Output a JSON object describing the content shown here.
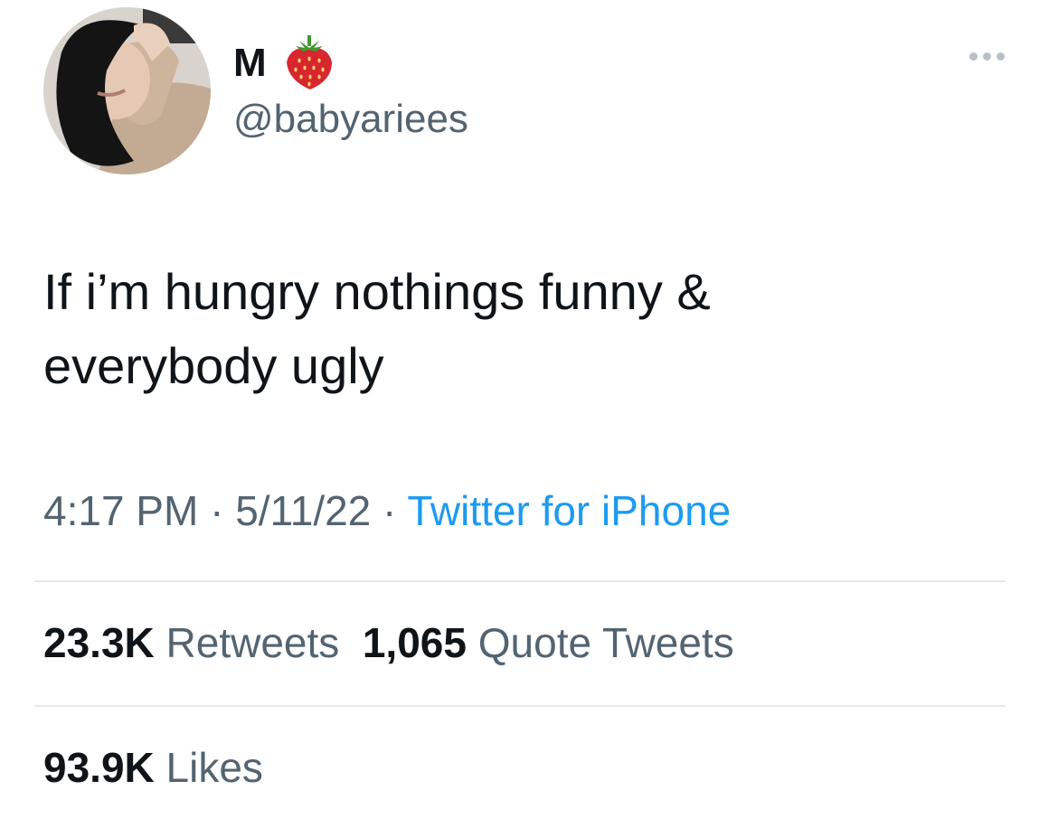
{
  "author": {
    "display_name": "M",
    "emoji": "strawberry",
    "handle": "@babyariees"
  },
  "tweet": {
    "text_lines": [
      "If i’m hungry nothings funny &",
      "everybody ugly"
    ],
    "time": "4:17 PM",
    "separator": "·",
    "date": "5/11/22",
    "source": "Twitter for iPhone"
  },
  "stats": {
    "retweets_count": "23.3K",
    "retweets_label": "Retweets",
    "quotes_count": "1,065",
    "quotes_label": "Quote Tweets",
    "likes_count": "93.9K",
    "likes_label": "Likes"
  },
  "colors": {
    "primary_text": "#0f1419",
    "secondary_text": "#536471",
    "link": "#1d9bf0",
    "divider": "#e6e9eb"
  }
}
